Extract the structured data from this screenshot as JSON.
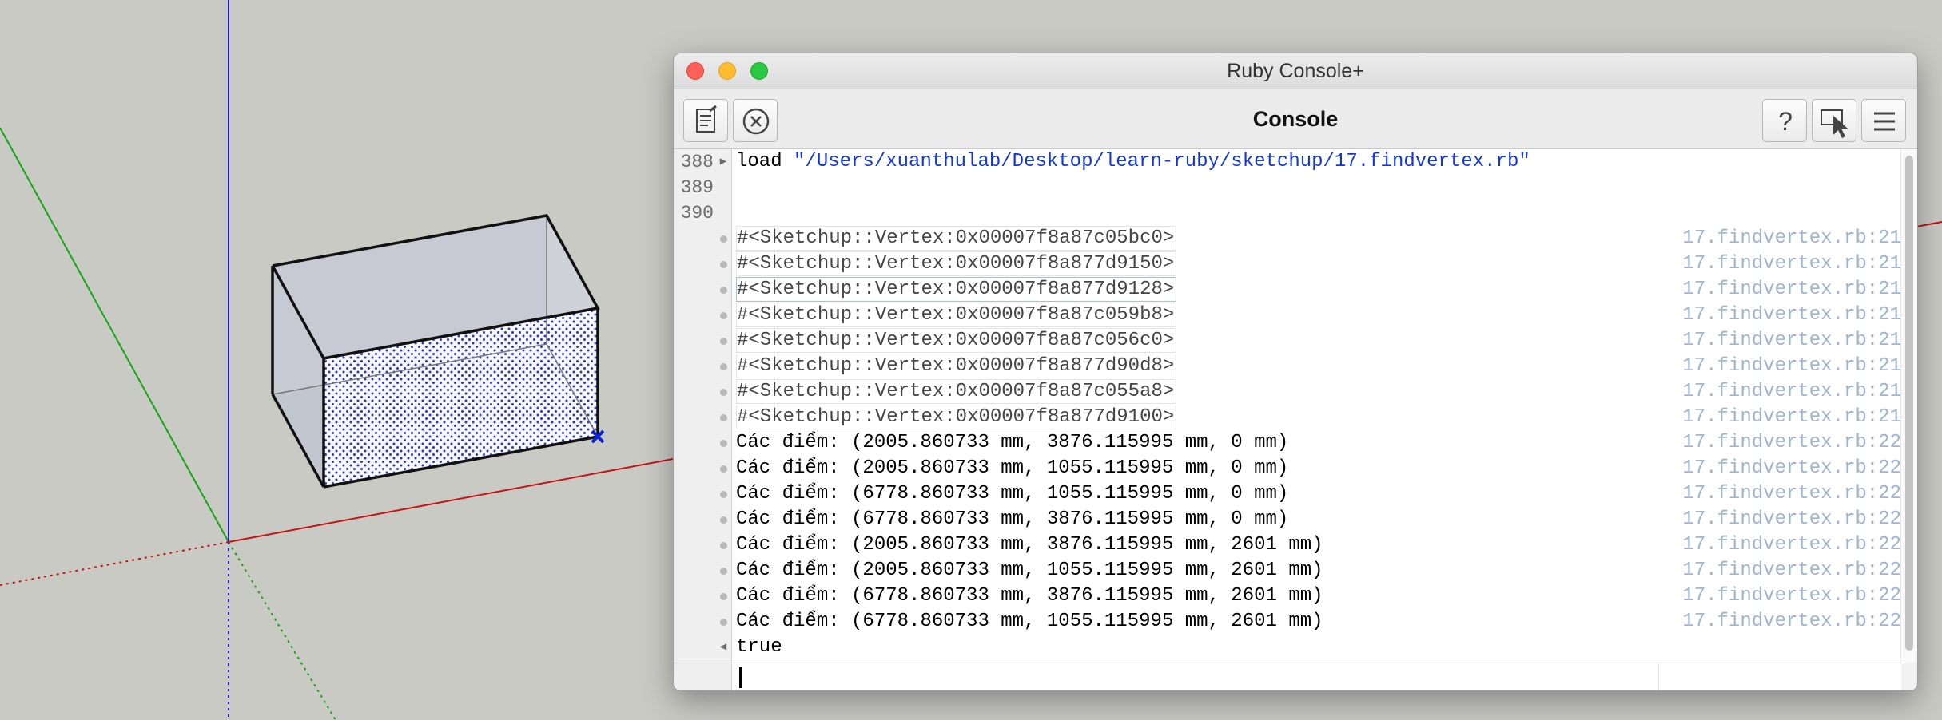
{
  "window": {
    "title": "Ruby Console+",
    "panel_title": "Console"
  },
  "toolbar": {
    "left_buttons": [
      "new-document-icon",
      "clear-icon"
    ],
    "right_buttons": [
      "help-icon",
      "select-pointer-icon",
      "menu-icon"
    ]
  },
  "console": {
    "lines": [
      {
        "num": "388",
        "marker": "▶",
        "command": "load",
        "argument": "\"/Users/xuanthulab/Desktop/learn-ruby/sketchup/17.findvertex.rb\""
      },
      {
        "num": "389"
      },
      {
        "num": "390"
      }
    ],
    "outputs": [
      {
        "text": "#<Sketchup::Vertex:0x00007f8a87c05bc0>",
        "source": "17.findvertex.rb:21"
      },
      {
        "text": "#<Sketchup::Vertex:0x00007f8a877d9150>",
        "source": "17.findvertex.rb:21"
      },
      {
        "text": "#<Sketchup::Vertex:0x00007f8a877d9128>",
        "source": "17.findvertex.rb:21"
      },
      {
        "text": "#<Sketchup::Vertex:0x00007f8a87c059b8>",
        "source": "17.findvertex.rb:21"
      },
      {
        "text": "#<Sketchup::Vertex:0x00007f8a87c056c0>",
        "source": "17.findvertex.rb:21"
      },
      {
        "text": "#<Sketchup::Vertex:0x00007f8a877d90d8>",
        "source": "17.findvertex.rb:21"
      },
      {
        "text": "#<Sketchup::Vertex:0x00007f8a87c055a8>",
        "source": "17.findvertex.rb:21"
      },
      {
        "text": "#<Sketchup::Vertex:0x00007f8a877d9100>",
        "source": "17.findvertex.rb:21"
      },
      {
        "text": "Các điểm: (2005.860733 mm, 3876.115995 mm, 0 mm)",
        "source": "17.findvertex.rb:22"
      },
      {
        "text": "Các điểm: (2005.860733 mm, 1055.115995 mm, 0 mm)",
        "source": "17.findvertex.rb:22"
      },
      {
        "text": "Các điểm: (6778.860733 mm, 1055.115995 mm, 0 mm)",
        "source": "17.findvertex.rb:22"
      },
      {
        "text": "Các điểm: (6778.860733 mm, 3876.115995 mm, 0 mm)",
        "source": "17.findvertex.rb:22"
      },
      {
        "text": "Các điểm: (2005.860733 mm, 3876.115995 mm, 2601 mm)",
        "source": "17.findvertex.rb:22"
      },
      {
        "text": "Các điểm: (2005.860733 mm, 1055.115995 mm, 2601 mm)",
        "source": "17.findvertex.rb:22"
      },
      {
        "text": "Các điểm: (6778.860733 mm, 3876.115995 mm, 2601 mm)",
        "source": "17.findvertex.rb:22"
      },
      {
        "text": "Các điểm: (6778.860733 mm, 1055.115995 mm, 2601 mm)",
        "source": "17.findvertex.rb:22"
      }
    ],
    "result": {
      "marker": "◀",
      "text": "true"
    },
    "input_value": ""
  },
  "colors": {
    "window_bg": "#f2f2f2",
    "source_link": "#9db5cf",
    "string_literal": "#1438d8",
    "axis_red": "#c41414",
    "axis_green": "#16a516",
    "axis_blue": "#1818d0",
    "selected_vertex": "#0b22d6"
  }
}
